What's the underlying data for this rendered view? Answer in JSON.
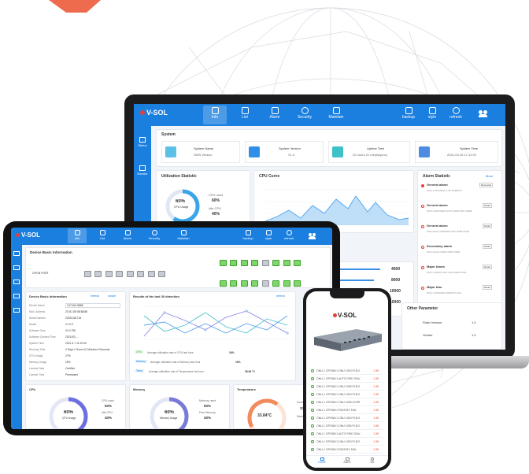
{
  "brand": {
    "logo_text": "V-SOL",
    "accent": "#1b7fe0",
    "alarm_red": "#e0413a",
    "ok_green": "#3aa63a"
  },
  "laptop": {
    "nav": [
      {
        "label": "Info",
        "icon": "info-icon",
        "active": true
      },
      {
        "label": "List",
        "icon": "list-icon"
      },
      {
        "label": "Alarm",
        "icon": "alarm-icon"
      },
      {
        "label": "Security",
        "icon": "security-icon"
      },
      {
        "label": "Maintain",
        "icon": "wrench-icon"
      }
    ],
    "nav_right": [
      {
        "label": "backup",
        "icon": "backup-icon"
      },
      {
        "label": "style",
        "icon": "style-icon"
      },
      {
        "label": "refresh",
        "icon": "refresh-icon"
      }
    ],
    "side": [
      {
        "label": "Status",
        "icon": "status-icon"
      },
      {
        "label": "Monitor",
        "icon": "monitor-icon"
      }
    ],
    "system_title": "System",
    "system_cards": [
      {
        "label": "System Name",
        "value": "GMS Version",
        "icon": "device-icon"
      },
      {
        "label": "System Version",
        "value": "V1.0",
        "icon": "info-icon"
      },
      {
        "label": "Uptime Time",
        "value": "22 hours 21 min(Approx)",
        "icon": "clock-icon"
      },
      {
        "label": "System Time",
        "value": "2021-03-15 17:11:00",
        "icon": "clock-icon"
      }
    ],
    "util_title": "Utilization Statistic",
    "util": {
      "percent": "60%",
      "center_label": "CPU Usage",
      "used_label": "CPU used",
      "used_value": "60%",
      "idle_label": "Idle CPU",
      "idle_value": "40%"
    },
    "cpu_title": "CPU Curve",
    "alarm_title": "Alarm Statistic",
    "alarm_more": "More",
    "alarms": [
      {
        "title": "General alarm",
        "badge": "Reconcile",
        "detail": "ONU-1 GPON/0/1 1:25 TIMEOUT",
        "color": "#e0413a"
      },
      {
        "title": "General alarm",
        "badge": "Detail",
        "detail": "ONU-1 GPON/0/1 AUTO FIND ONU OVER",
        "color": "#e0413a"
      },
      {
        "title": "General alarm",
        "badge": "Detail",
        "detail": "ONU admin GPON/0/1 ONU 1005 PLDG",
        "color": "#e0413a"
      },
      {
        "title": "Secondary alarm",
        "badge": "Detail",
        "detail": "ONU admin GPON 1005 OVER",
        "color": "#e0413a"
      },
      {
        "title": "Major Alarm",
        "badge": "Detail",
        "detail": "ONU 1 GPON 1/0/1 ONU 1003 PLDG",
        "color": "#e0413a"
      },
      {
        "title": "Major Alar",
        "badge": "Detail",
        "detail": "ONU 1 GPON/0/1 PASS BY FAIL",
        "color": "#e0413a"
      }
    ],
    "traffic_values": [
      "4000",
      "8000",
      "10000",
      "10000"
    ],
    "other_param_title": "Other Parameter",
    "other_params": [
      {
        "label": "Flash Version",
        "value": "1.0"
      },
      {
        "label": "Vendor",
        "value": "1.0"
      }
    ]
  },
  "tablet": {
    "nav": [
      {
        "label": "Info",
        "icon": "info-icon",
        "active": true
      },
      {
        "label": "List",
        "icon": "list-icon"
      },
      {
        "label": "Alarm",
        "icon": "alarm-icon"
      },
      {
        "label": "Security",
        "icon": "security-icon"
      },
      {
        "label": "Maintain",
        "icon": "wrench-icon"
      }
    ],
    "nav_right": [
      {
        "label": "backup",
        "icon": "backup-icon"
      },
      {
        "label": "style",
        "icon": "style-icon"
      },
      {
        "label": "refresh",
        "icon": "refresh-icon"
      }
    ],
    "device_basic_title": "Device Basic Information",
    "gpon_label": "GPON PORT",
    "device_info_title": "Device Basic Information",
    "refresh_label": "refresh",
    "cancel_label": "cancel",
    "info_rows": [
      {
        "label": "Device Name",
        "value": "V2724G-8888"
      },
      {
        "label": "MAC Address",
        "value": "20:3C:DE:88:88:88"
      },
      {
        "label": "Serial Number",
        "value": "22020181718"
      },
      {
        "label": "Model",
        "value": "V1.0.9"
      },
      {
        "label": "Software Vers",
        "value": "V2.0.750"
      },
      {
        "label": "Software Created Time",
        "value": "2021/3/3 ..."
      },
      {
        "label": "System Time",
        "value": "2021-3-7 11:19:00"
      },
      {
        "label": "Running Time",
        "value": "0 Days 2 Hours 31 Minutes 8 Seconds"
      },
      {
        "label": "CPU Usage",
        "value": "27%"
      },
      {
        "label": "Memory Usage",
        "value": "16%"
      },
      {
        "label": "License Date",
        "value": "Certified"
      },
      {
        "label": "License Time",
        "value": "Permanent"
      }
    ],
    "results_title": "Results of the last 30 detection",
    "results_refresh": "refresh",
    "results_lines": [
      {
        "badge": "CPU",
        "text": "Average utilization rate of CPU last hour",
        "value": "34%"
      },
      {
        "badge": "Memory",
        "text": "Average utilization rate of Memory last hour",
        "value": "19%"
      },
      {
        "badge": "Temp",
        "text": "Average utilization rate of Temperature last hour",
        "value": "36.84 °C"
      }
    ],
    "cpu_card": {
      "title": "CPU",
      "percent": "60%",
      "center_label": "CPU Usage",
      "used_label": "CPU used",
      "used_value": "60%",
      "idle_label": "Idle CPU",
      "idle_value": "40%"
    },
    "mem_card": {
      "title": "Memory",
      "percent": "60%",
      "center_label": "Memory Usage",
      "used_label": "Memory used",
      "used_value": "60%",
      "free_label": "Free Memory",
      "free_value": "40%"
    },
    "temp_card": {
      "title": "Temperature",
      "value": "33.84°C",
      "current_label": "Current Temp",
      "current_value": "33.84",
      "max_label": "Maximum temp"
    }
  },
  "phone": {
    "logo_text": "V-SOL",
    "rows": [
      {
        "text": "ONU-1 GPON0/1 ONU 1003 PLDG",
        "value": "1.98"
      },
      {
        "text": "ONU-1 GPON0/1 AUTO FIND ONU",
        "value": "1.98"
      },
      {
        "text": "ONU-1 GPON0/1 ONU 1005 PLDG",
        "value": "1.98"
      },
      {
        "text": "ONU-1 GPON0/1 ONU 1003 PLDG",
        "value": "1.98"
      },
      {
        "text": "ONU-1 GPON0/1 ONU 1005 OVER",
        "value": "1.98"
      },
      {
        "text": "ONU-1 GPON0/1 PASS BY FAIL",
        "value": "1.98"
      },
      {
        "text": "ONU-1 GPON0/1 ONU 1003 PLDG",
        "value": "1.98"
      },
      {
        "text": "ONU-1 GPON0/1 ONU 1005 PLDG",
        "value": "1.98"
      },
      {
        "text": "ONU-1 GPON0/1 AUTO FIND ONU",
        "value": "1.98"
      },
      {
        "text": "ONU-1 GPON0/1 ONU 1003 PLDG",
        "value": "1.98"
      },
      {
        "text": "ONU-1 GPON0/1 PASS BY FAIL",
        "value": "1.98"
      }
    ],
    "tabbar": [
      {
        "label": "Home",
        "icon": "home-icon"
      },
      {
        "label": "Alarm",
        "icon": "alarm-icon"
      },
      {
        "label": "Me",
        "icon": "user-icon"
      }
    ]
  }
}
